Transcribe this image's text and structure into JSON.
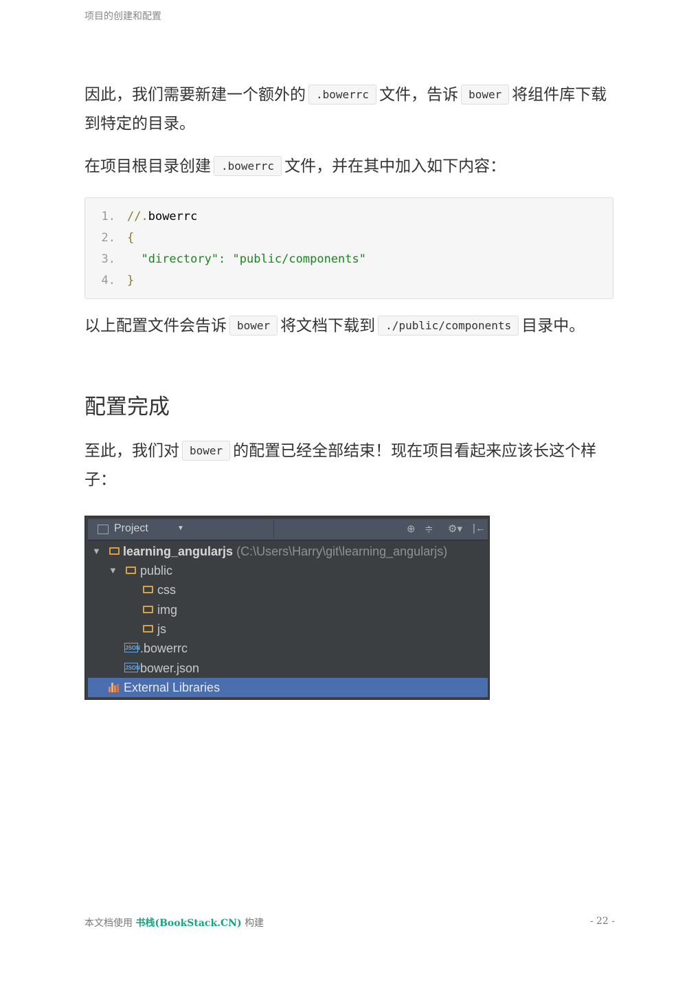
{
  "header": {
    "title": "项目的创建和配置"
  },
  "para1": {
    "t1": "因此，我们需要新建一个额外的",
    "c1": ".bowerrc",
    "t2": "文件，告诉",
    "c2": "bower",
    "t3": "将组件库下载到特定的目录。"
  },
  "para2": {
    "t1": "在项目根目录创建",
    "c1": ".bowerrc",
    "t2": "文件，并在其中加入如下内容："
  },
  "code": {
    "lines": [
      {
        "num": "1.",
        "comment": "//.",
        "plain": "bowerrc"
      },
      {
        "num": "2.",
        "punc": "{"
      },
      {
        "num": "3.",
        "str": "  \"directory\": \"public/components\""
      },
      {
        "num": "4.",
        "punc": "}"
      }
    ]
  },
  "para3": {
    "t1": "以上配置文件会告诉",
    "c1": "bower",
    "t2": "将文档下载到",
    "c2": "./public/components",
    "t3": "目录中。"
  },
  "section": {
    "heading": "配置完成"
  },
  "para4": {
    "t1": "至此，我们对",
    "c1": "bower",
    "t2": "的配置已经全部结束！现在项目看起来应该长这个样子："
  },
  "ide": {
    "panel_title": "Project",
    "tools": [
      "⊕",
      "≑",
      "⚙▾",
      "|←"
    ],
    "root": {
      "name": "learning_angularjs",
      "path": "(C:\\Users\\Harry\\git\\learning_angularjs)"
    },
    "public": "public",
    "css": "css",
    "img": "img",
    "js": "js",
    "bowerrc": ".bowerrc",
    "bower_json": "bower.json",
    "json_badge": "JSON",
    "external": "External Libraries",
    "colors": {
      "background": "#3c3f41",
      "selection": "#4b6eaf",
      "folder": "#d9a343"
    }
  },
  "footer": {
    "prefix": "本文档使用",
    "brand": "书栈(BookStack.CN)",
    "suffix": "构建",
    "page": "- 22 -",
    "brand_color": "#1aa184"
  }
}
